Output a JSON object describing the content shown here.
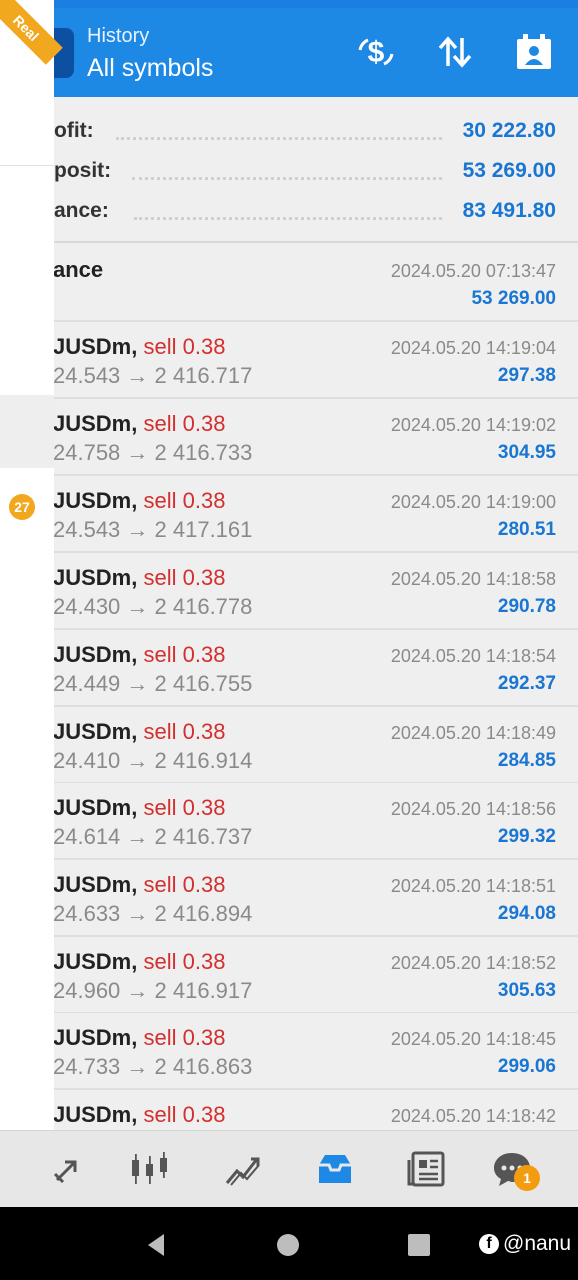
{
  "header": {
    "subtitle": "History",
    "title": "All symbols",
    "account_badge": "Real",
    "icons": [
      "deposit-currency-icon",
      "sort-icon",
      "calendar-icon"
    ]
  },
  "summary": [
    {
      "label": "ofit:",
      "value": "30 222.80"
    },
    {
      "label": "posit:",
      "value": "53 269.00"
    },
    {
      "label": "ance:",
      "value": "83 491.80"
    }
  ],
  "balance_row": {
    "title": "ance",
    "time": "2024.05.20 07:13:47",
    "amount": "53 269.00"
  },
  "trades": [
    {
      "symbol": "JUSDm,",
      "side": "sell 0.38",
      "prices": "24.543 → 2 416.717",
      "time": "2024.05.20 14:19:04",
      "profit": "297.38"
    },
    {
      "symbol": "JUSDm,",
      "side": "sell 0.38",
      "prices": "24.758 → 2 416.733",
      "time": "2024.05.20 14:19:02",
      "profit": "304.95"
    },
    {
      "symbol": "JUSDm,",
      "side": "sell 0.38",
      "prices": "24.543 → 2 417.161",
      "time": "2024.05.20 14:19:00",
      "profit": "280.51"
    },
    {
      "symbol": "JUSDm,",
      "side": "sell 0.38",
      "prices": "24.430 → 2 416.778",
      "time": "2024.05.20 14:18:58",
      "profit": "290.78"
    },
    {
      "symbol": "JUSDm,",
      "side": "sell 0.38",
      "prices": "24.449 → 2 416.755",
      "time": "2024.05.20 14:18:54",
      "profit": "292.37"
    },
    {
      "symbol": "JUSDm,",
      "side": "sell 0.38",
      "prices": "24.410 → 2 416.914",
      "time": "2024.05.20 14:18:49",
      "profit": "284.85"
    },
    {
      "symbol": "JUSDm,",
      "side": "sell 0.38",
      "prices": "24.614 → 2 416.737",
      "time": "2024.05.20 14:18:56",
      "profit": "299.32"
    },
    {
      "symbol": "JUSDm,",
      "side": "sell 0.38",
      "prices": "24.633 → 2 416.894",
      "time": "2024.05.20 14:18:51",
      "profit": "294.08"
    },
    {
      "symbol": "JUSDm,",
      "side": "sell 0.38",
      "prices": "24.960 → 2 416.917",
      "time": "2024.05.20 14:18:52",
      "profit": "305.63"
    },
    {
      "symbol": "JUSDm,",
      "side": "sell 0.38",
      "prices": "24.733 → 2 416.863",
      "time": "2024.05.20 14:18:45",
      "profit": "299.06"
    },
    {
      "symbol": "JUSDm,",
      "side": "sell 0.38",
      "prices": "",
      "time": "2024.05.20 14:18:42",
      "profit": ""
    }
  ],
  "left_panel": {
    "notification_count": "27"
  },
  "tabbar": {
    "tabs": [
      "quotes-icon",
      "chart-candles-icon",
      "trade-icon",
      "history-icon",
      "news-icon",
      "chat-icon"
    ],
    "active": "history-icon",
    "chat_badge": "1"
  },
  "watermark": {
    "text": "@nanu",
    "logo": "f"
  },
  "colors": {
    "header": "#1e88e5",
    "value_blue": "#1976d2",
    "sell_red": "#d32f2f",
    "badge_orange": "#f2a81e"
  }
}
